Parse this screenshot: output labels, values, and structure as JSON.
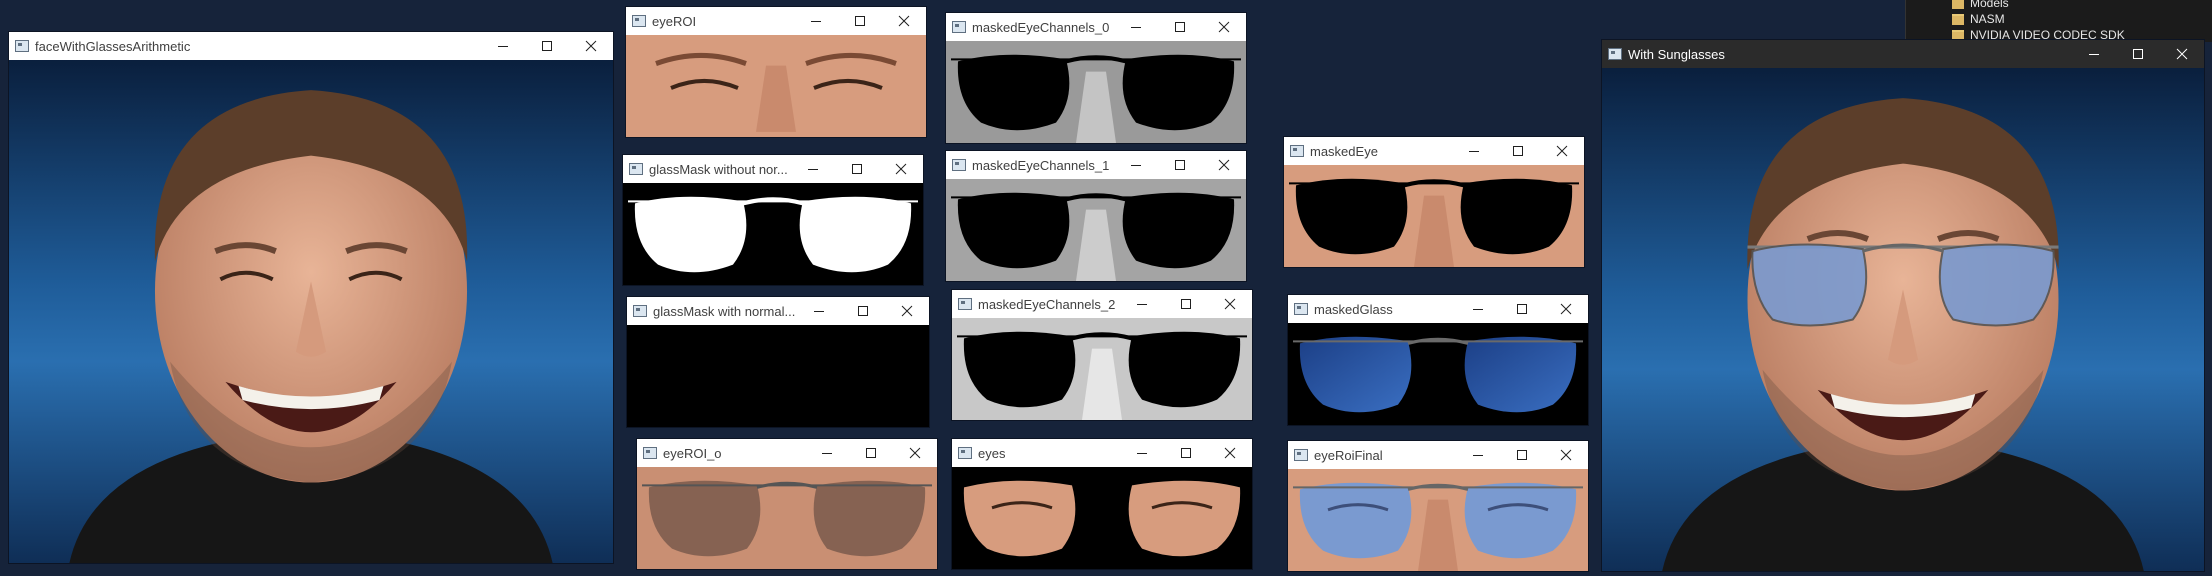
{
  "windows": {
    "face_with_glasses": {
      "title": "faceWithGlassesArithmetic"
    },
    "eye_roi": {
      "title": "eyeROI"
    },
    "glass_mask_without_norm": {
      "title": "glassMask without nor..."
    },
    "glass_mask_with_norm": {
      "title": "glassMask with normal..."
    },
    "eye_roi_o": {
      "title": "eyeROI_o"
    },
    "masked_eye_channels_0": {
      "title": "maskedEyeChannels_0"
    },
    "masked_eye_channels_1": {
      "title": "maskedEyeChannels_1"
    },
    "masked_eye_channels_2": {
      "title": "maskedEyeChannels_2"
    },
    "eyes": {
      "title": "eyes"
    },
    "masked_eye": {
      "title": "maskedEye"
    },
    "masked_glass": {
      "title": "maskedGlass"
    },
    "eye_roi_final": {
      "title": "eyeRoiFinal"
    },
    "with_sunglasses": {
      "title": "With Sunglasses"
    }
  },
  "window_controls": {
    "minimize_icon": "minimize-icon",
    "maximize_icon": "maximize-icon",
    "close_icon": "close-icon"
  },
  "explorer": {
    "folders": [
      "Models",
      "NASM",
      "NVIDIA VIDEO CODEC SDK"
    ]
  },
  "colors": {
    "desktop": "#16233a",
    "titlebar": "#ffffff",
    "titlebar_dark": "#2b2b2b",
    "folder": "#dcb765"
  }
}
